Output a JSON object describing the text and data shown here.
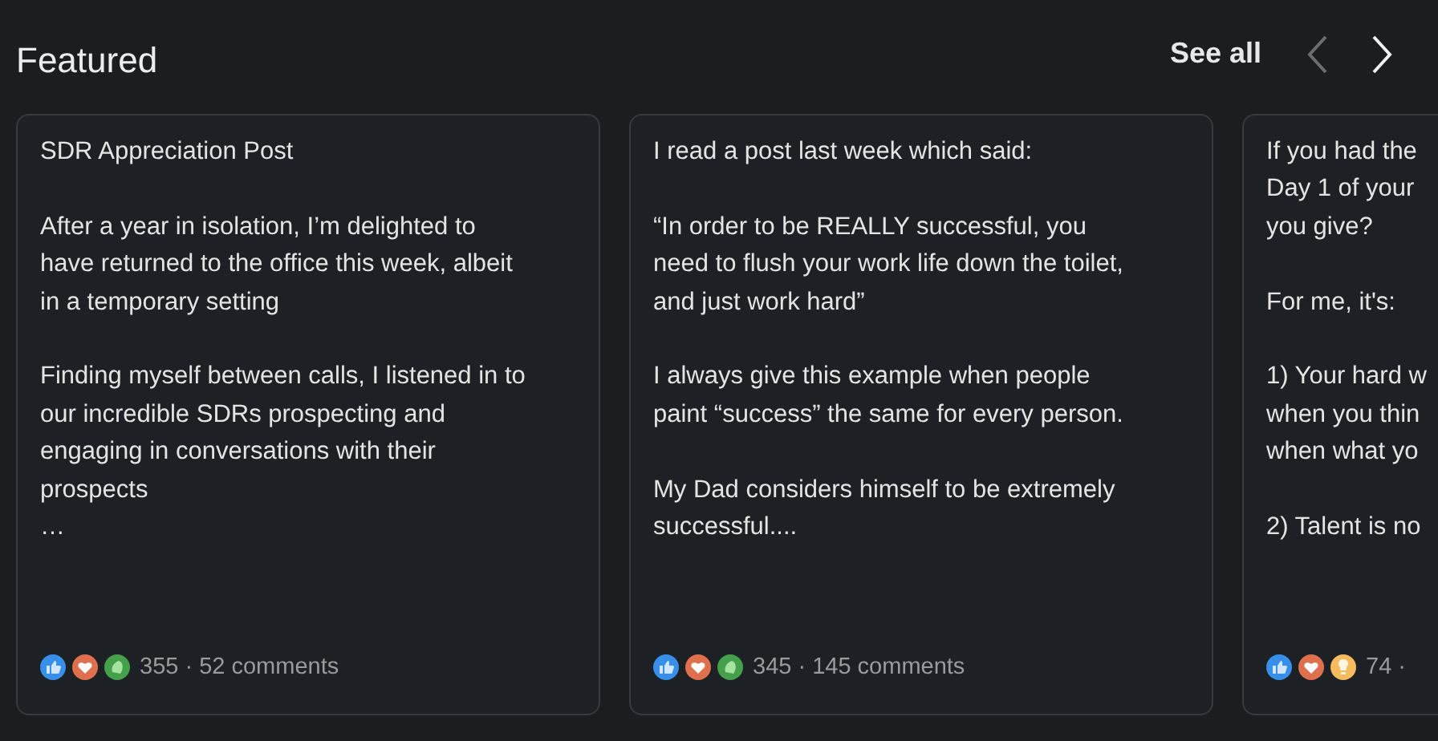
{
  "section": {
    "title": "Featured",
    "see_all": "See all"
  },
  "nav": [
    {
      "kind": "prev",
      "disabled": true
    },
    {
      "kind": "next",
      "disabled": false
    }
  ],
  "cards": [
    {
      "paragraphs": [
        [
          "SDR Appreciation Post"
        ],
        [
          "After a year in isolation, I’m delighted to",
          "have returned to the office this week, albeit",
          "in a temporary setting"
        ],
        [
          "Finding myself between calls, I listened in to",
          "our incredible SDRs prospecting and",
          "engaging in conversations with their",
          "prospects",
          "…"
        ]
      ],
      "reactions": [
        {
          "kind": "like"
        },
        {
          "kind": "love"
        },
        {
          "kind": "celebrate"
        }
      ],
      "stats": "355 · 52 comments",
      "cut": false
    },
    {
      "paragraphs": [
        [
          "I read a post last week which said:"
        ],
        [
          "“In order to be REALLY successful, you",
          "need to flush your work life down the toilet,",
          "and just work hard”"
        ],
        [
          "I always give this example when people",
          "paint “success” the same for every person."
        ],
        [
          "My Dad considers himself to be extremely",
          "successful...."
        ]
      ],
      "reactions": [
        {
          "kind": "like"
        },
        {
          "kind": "love"
        },
        {
          "kind": "celebrate"
        }
      ],
      "stats": "345 · 145 comments",
      "cut": false
    },
    {
      "paragraphs": [
        [
          "If you had the",
          "Day 1 of your",
          "you give?"
        ],
        [
          "For me, it's:"
        ],
        [
          "1) Your hard w",
          "when you thin",
          "when what yo"
        ],
        [
          "2) Talent is no"
        ]
      ],
      "reactions": [
        {
          "kind": "like"
        },
        {
          "kind": "love"
        },
        {
          "kind": "insightful"
        }
      ],
      "stats": "74 ·",
      "cut": true
    }
  ]
}
